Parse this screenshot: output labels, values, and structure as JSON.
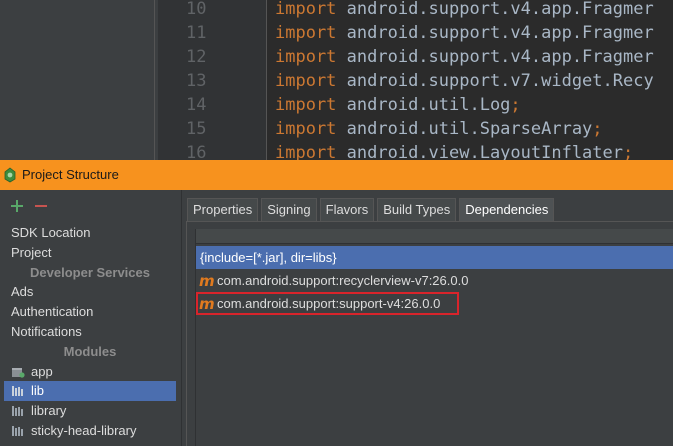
{
  "editor": {
    "lines": [
      {
        "num": "10",
        "keyword": "import",
        "text": " android.support.v4.app.Fragmer",
        "semicolon": ""
      },
      {
        "num": "11",
        "keyword": "import",
        "text": " android.support.v4.app.Fragmer",
        "semicolon": ""
      },
      {
        "num": "12",
        "keyword": "import",
        "text": " android.support.v4.app.Fragmer",
        "semicolon": ""
      },
      {
        "num": "13",
        "keyword": "import",
        "text": " android.support.v7.widget.Recy",
        "semicolon": ""
      },
      {
        "num": "14",
        "keyword": "import",
        "text": " android.util.Log",
        "semicolon": ";"
      },
      {
        "num": "15",
        "keyword": "import",
        "text": " android.util.SparseArray",
        "semicolon": ";"
      },
      {
        "num": "16",
        "keyword": "import",
        "text": " android.view.LayoutInflater",
        "semicolon": ";"
      }
    ]
  },
  "dialog": {
    "title": "Project Structure"
  },
  "sidebar": {
    "items": [
      {
        "label": "SDK Location",
        "type": "item"
      },
      {
        "label": "Project",
        "type": "item"
      },
      {
        "label": "Developer Services",
        "type": "header"
      },
      {
        "label": "Ads",
        "type": "item"
      },
      {
        "label": "Authentication",
        "type": "item"
      },
      {
        "label": "Notifications",
        "type": "item"
      },
      {
        "label": "Modules",
        "type": "header"
      },
      {
        "label": "app",
        "type": "module"
      },
      {
        "label": "lib",
        "type": "module",
        "selected": true
      },
      {
        "label": "library",
        "type": "module"
      },
      {
        "label": "sticky-head-library",
        "type": "module"
      }
    ]
  },
  "tabs": [
    {
      "label": "Properties"
    },
    {
      "label": "Signing"
    },
    {
      "label": "Flavors"
    },
    {
      "label": "Build Types"
    },
    {
      "label": "Dependencies",
      "active": true
    }
  ],
  "dependencies": [
    {
      "label": "{include=[*.jar], dir=libs}",
      "selected": true,
      "icon": ""
    },
    {
      "label": "com.android.support:recyclerview-v7:26.0.0",
      "icon": "maven-icon",
      "icon_glyph": "m"
    },
    {
      "label": "com.android.support:support-v4:26.0.0",
      "icon": "maven-icon",
      "icon_glyph": "m",
      "highlighted": true
    }
  ],
  "colors": {
    "titlebar": "#f7921e",
    "selection": "#4b6eaf",
    "highlight_box": "#d9242b",
    "keyword": "#cc7832",
    "add": "#59a869",
    "remove": "#c75450"
  }
}
